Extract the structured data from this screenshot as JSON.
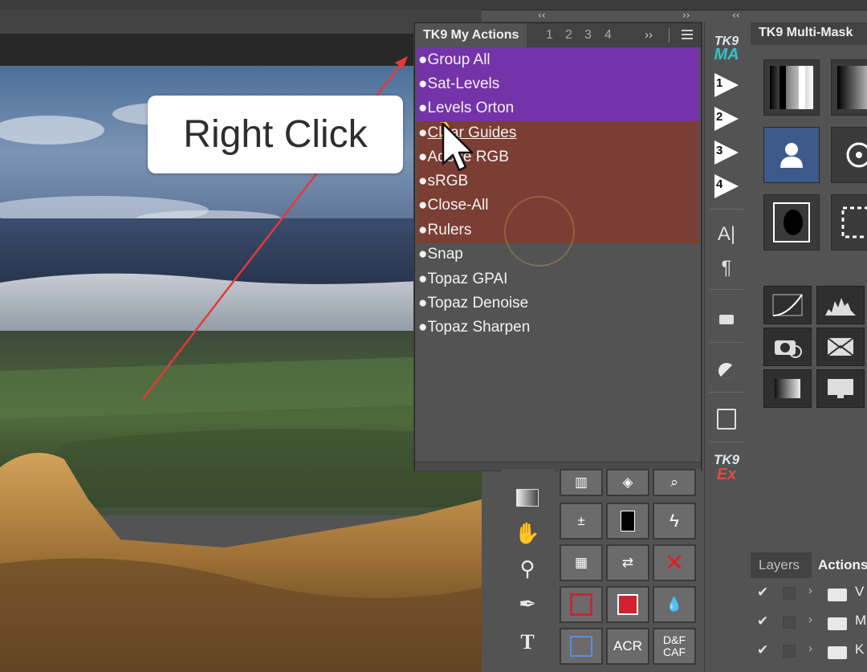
{
  "callout": {
    "text": "Right Click"
  },
  "my_actions": {
    "title": "TK9 My Actions",
    "tabs": [
      "1",
      "2",
      "3",
      "4"
    ],
    "more": "››",
    "items": [
      {
        "label": "Group All"
      },
      {
        "label": "Sat-Levels"
      },
      {
        "label": "Levels Orton"
      },
      {
        "label": "Clear Guides"
      },
      {
        "label": "Adobe RGB"
      },
      {
        "label": "sRGB"
      },
      {
        "label": "Close-All"
      },
      {
        "label": "Rulers"
      },
      {
        "label": "Snap"
      },
      {
        "label": "Topaz GPAI"
      },
      {
        "label": "Topaz Denoise"
      },
      {
        "label": "Topaz Sharpen"
      }
    ],
    "group_colors": {
      "purple": "#7433a8",
      "red": "#7b3e35"
    }
  },
  "strip": {
    "logo_top": "TK9",
    "logo_sub": "MA",
    "play_buttons": [
      "1",
      "2",
      "3",
      "4"
    ],
    "logo2_top": "TK9",
    "logo2_sub": "Ex"
  },
  "multimask": {
    "title": "TK9 Multi-Mask"
  },
  "grid_buttons": {
    "acr": "ACR",
    "dfcaf": "D&F\nCAF"
  },
  "layers_panel": {
    "tabs": [
      "Layers",
      "Actions"
    ],
    "rows": [
      {
        "label": "V"
      },
      {
        "label": "M"
      },
      {
        "label": "K"
      }
    ]
  },
  "collapse_glyphs": {
    "left": "‹‹",
    "right": "››"
  },
  "accent": {
    "arrow": "#e5383b",
    "highlight": "#f2d31a"
  }
}
